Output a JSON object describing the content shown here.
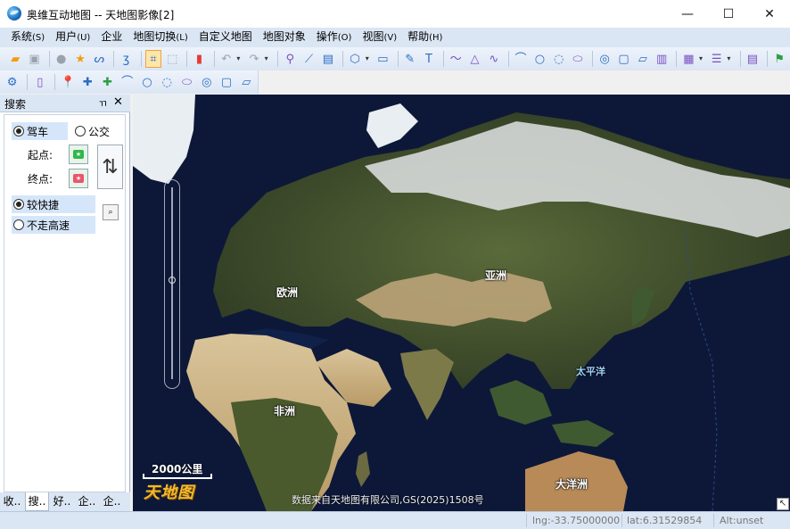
{
  "window": {
    "title": "奥维互动地图 -- 天地图影像[2]",
    "minimize": "—",
    "maximize": "☐",
    "close": "✕"
  },
  "menu": [
    {
      "label": "系统",
      "key": "(S)"
    },
    {
      "label": "用户",
      "key": "(U)"
    },
    {
      "label": "企业",
      "key": ""
    },
    {
      "label": "地图切换",
      "key": "(L)"
    },
    {
      "label": "自定义地图",
      "key": ""
    },
    {
      "label": "地图对象",
      "key": ""
    },
    {
      "label": "操作",
      "key": "(O)"
    },
    {
      "label": "视图",
      "key": "(V)"
    },
    {
      "label": "帮助",
      "key": "(H)"
    }
  ],
  "icons": {
    "toolbar1": [
      "folder-open-icon",
      "save-icon",
      "user-icon",
      "star-icon",
      "route-icon",
      "3d-icon",
      "select-icon",
      "dashed-rect-icon",
      "delete-icon",
      "undo-icon",
      "redo-icon",
      "marker-icon",
      "ruler-icon",
      "elevation-icon",
      "polygon-icon",
      "video-icon",
      "pin-icon",
      "text-icon",
      "polyline-icon",
      "triangle-icon",
      "curve-icon",
      "arc-icon",
      "circle-icon",
      "arc-ccw-icon",
      "ellipse-icon",
      "circle-fill-icon",
      "rect-round-icon",
      "parallelogram-icon",
      "layers-icon",
      "list-icon",
      "table-icon",
      "flag-icon"
    ],
    "toolbar2": [
      "settings-icon",
      "file-icon",
      "pin-yellow-icon",
      "pin-blue-icon",
      "pin-green-icon",
      "arc-icon",
      "circle-icon",
      "arc-ccw-icon",
      "ellipse-icon",
      "circle-fill-icon",
      "rect-round-icon",
      "parallelogram-icon"
    ]
  },
  "colors": {
    "accent": "#dbe6f4",
    "selected": "#d6e6fa",
    "map_ocean": "#0d1838"
  },
  "search_panel": {
    "title": "搜索",
    "pin": "ㄲ",
    "close": "✕",
    "mode_drive": "驾车",
    "mode_bus": "公交",
    "start_label": "起点:",
    "end_label": "终点:",
    "swap": "⇅",
    "option_fast": "较快捷",
    "option_no_highway": "不走高速",
    "tabs": [
      "收..",
      "搜..",
      "好..",
      "企..",
      "企.."
    ]
  },
  "map": {
    "labels": {
      "europe": "欧洲",
      "asia": "亚洲",
      "pacific": "太平洋",
      "africa": "非洲",
      "oceania": "大洋洲"
    },
    "scale": "2000公里",
    "logo": "天地图",
    "copyright": "数据来自天地图有限公司,GS(2025)1508号"
  },
  "status": {
    "lng": "lng:-33.75000000",
    "lat": "lat:6.31529854",
    "alt": "Alt:unset"
  }
}
